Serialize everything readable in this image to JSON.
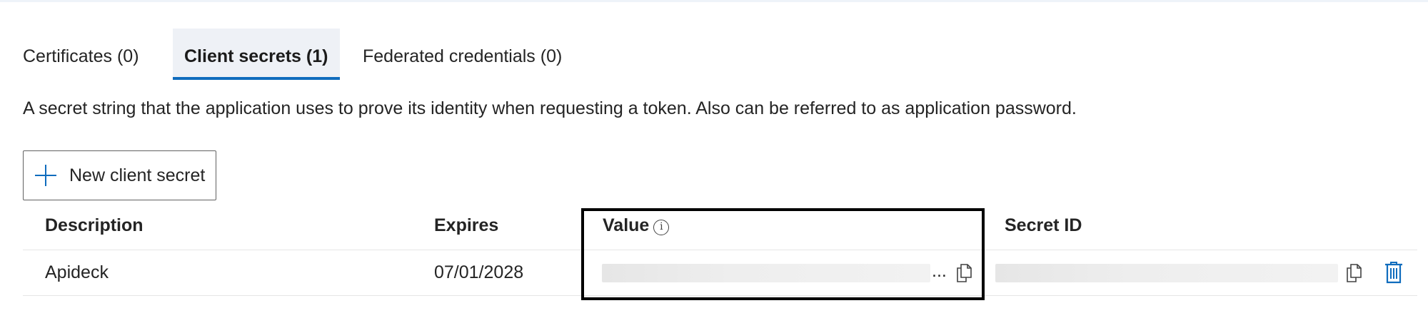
{
  "tabs": [
    {
      "label": "Certificates (0)",
      "active": false
    },
    {
      "label": "Client secrets (1)",
      "active": true
    },
    {
      "label": "Federated credentials (0)",
      "active": false
    }
  ],
  "description": "A secret string that the application uses to prove its identity when requesting a token. Also can be referred to as application password.",
  "new_button": {
    "label": "New client secret",
    "icon": "plus-icon"
  },
  "table": {
    "columns": {
      "description": "Description",
      "expires": "Expires",
      "value": "Value",
      "secret_id": "Secret ID"
    },
    "value_info_icon": "info-icon",
    "rows": [
      {
        "description": "Apideck",
        "expires": "07/01/2028",
        "value_truncation": "...",
        "value_masked": true,
        "secret_id_masked": true
      }
    ]
  },
  "colors": {
    "accent": "#0f6cbd",
    "highlight_border": "#000000",
    "active_tab_bg": "#eef1f6"
  },
  "icons": [
    "plus-icon",
    "info-icon",
    "copy-icon",
    "delete-icon"
  ]
}
